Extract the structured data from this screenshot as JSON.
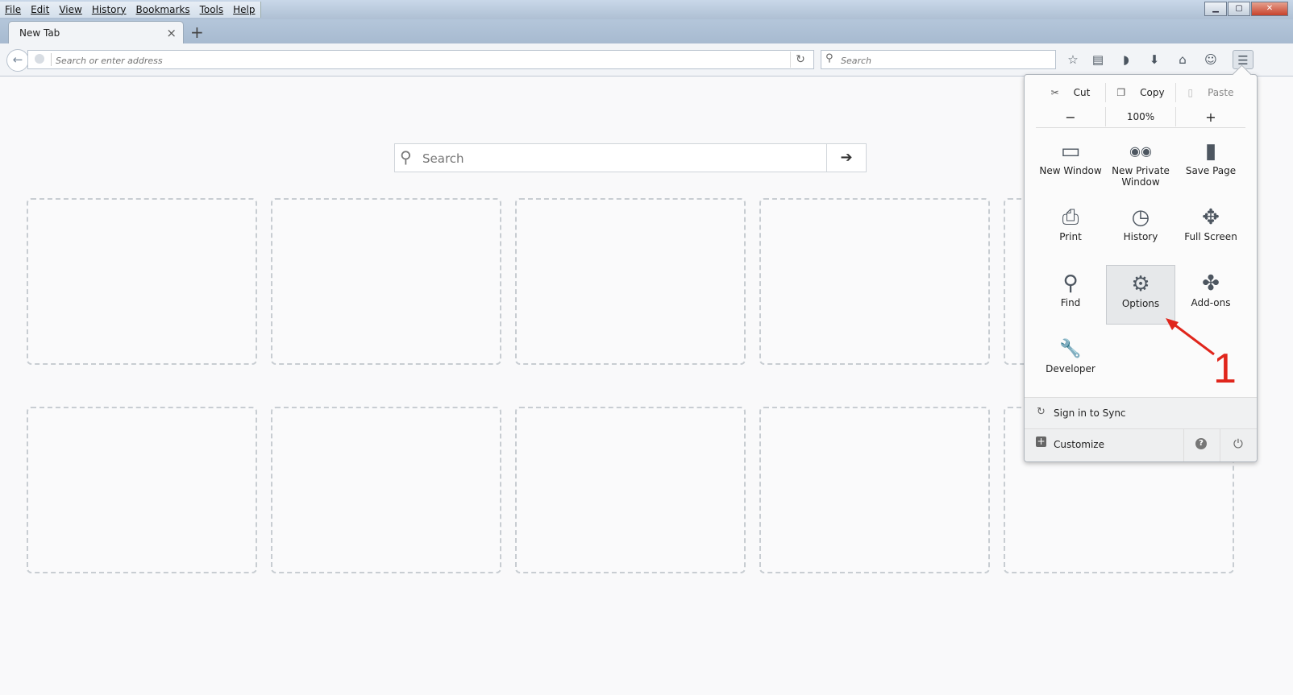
{
  "menubar": {
    "items": [
      "File",
      "Edit",
      "View",
      "History",
      "Bookmarks",
      "Tools",
      "Help"
    ]
  },
  "window_controls": {
    "minimize": "▁",
    "maximize": "▢",
    "close": "✕"
  },
  "tab": {
    "title": "New Tab",
    "close": "×"
  },
  "newtab_button": "+",
  "urlbar": {
    "placeholder": "Search or enter address"
  },
  "searchbar": {
    "placeholder": "Search"
  },
  "content_search": {
    "placeholder": "Search",
    "go": "➔"
  },
  "menu_panel": {
    "edit": {
      "cut": "Cut",
      "copy": "Copy",
      "paste": "Paste"
    },
    "zoom": {
      "minus": "−",
      "level": "100%",
      "plus": "+"
    },
    "items": [
      {
        "label": "New Window",
        "icon": "new-window-icon",
        "glyph": "▭"
      },
      {
        "label": "New Private Window",
        "icon": "private-mask-icon",
        "glyph": "◉◉"
      },
      {
        "label": "Save Page",
        "icon": "save-page-icon",
        "glyph": "▮"
      },
      {
        "label": "Print",
        "icon": "printer-icon",
        "glyph": "⎙"
      },
      {
        "label": "History",
        "icon": "clock-icon",
        "glyph": "◷"
      },
      {
        "label": "Full Screen",
        "icon": "fullscreen-icon",
        "glyph": "✥"
      },
      {
        "label": "Find",
        "icon": "magnifier-icon",
        "glyph": "⚲"
      },
      {
        "label": "Options",
        "icon": "gear-icon",
        "glyph": "⚙"
      },
      {
        "label": "Add-ons",
        "icon": "puzzle-icon",
        "glyph": "✤"
      },
      {
        "label": "Developer",
        "icon": "wrench-icon",
        "glyph": "🔧"
      }
    ],
    "sync_label": "Sign in to Sync",
    "customize_label": "Customize",
    "help_glyph": "?",
    "power_glyph": "⏻"
  },
  "annotation": {
    "label": "1",
    "color": "#e0261c"
  }
}
